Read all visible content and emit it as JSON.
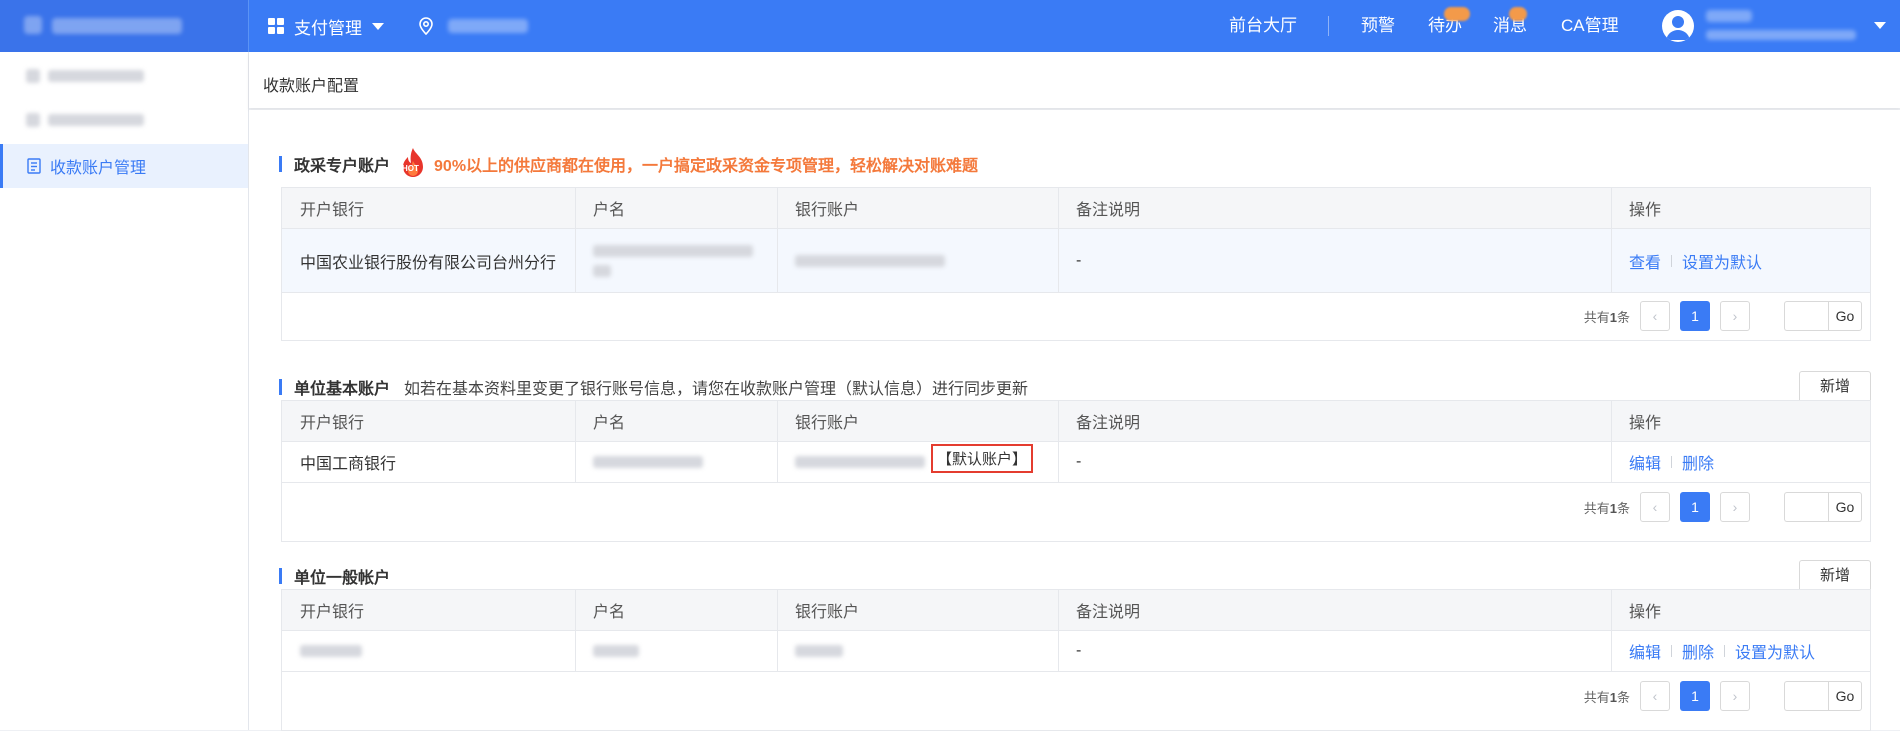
{
  "topbar": {
    "menu_label": "支付管理",
    "nav": [
      "前台大厅",
      "预警",
      "待办",
      "消息",
      "CA管理"
    ]
  },
  "sidebar": {
    "active_label": "收款账户管理"
  },
  "breadcrumb": "收款账户配置",
  "columns": [
    "开户银行",
    "户名",
    "银行账户",
    "备注说明",
    "操作"
  ],
  "sections": [
    {
      "title": "政采专户账户",
      "hot_badge": "HOT",
      "promo": "90%以上的供应商都在使用，一户搞定政采资金专项管理，轻松解决对账难题",
      "rows": [
        {
          "bank": "中国农业银行股份有限公司台州分行",
          "remark": "-",
          "ops": [
            "查看",
            "设置为默认"
          ]
        }
      ],
      "pager": {
        "total_prefix": "共有",
        "total_count": "1",
        "total_suffix": "条",
        "page": "1",
        "go": "Go"
      }
    },
    {
      "title": "单位基本账户",
      "hint": "如若在基本资料里变更了银行账号信息，请您在收款账户管理（默认信息）进行同步更新",
      "add_label": "新增",
      "rows": [
        {
          "bank": "中国工商银行",
          "default_tag": "【默认账户】",
          "remark": "-",
          "ops": [
            "编辑",
            "删除"
          ]
        }
      ],
      "pager": {
        "total_prefix": "共有",
        "total_count": "1",
        "total_suffix": "条",
        "page": "1",
        "go": "Go"
      }
    },
    {
      "title": "单位一般帐户",
      "add_label": "新增",
      "rows": [
        {
          "remark": "-",
          "ops": [
            "编辑",
            "删除",
            "设置为默认"
          ]
        }
      ],
      "pager": {
        "total_prefix": "共有",
        "total_count": "1",
        "total_suffix": "条",
        "page": "1",
        "go": "Go"
      }
    }
  ],
  "colors": {
    "primary": "#3a7bf5",
    "promo": "#f4793b",
    "highlight": "#e43c2f"
  }
}
